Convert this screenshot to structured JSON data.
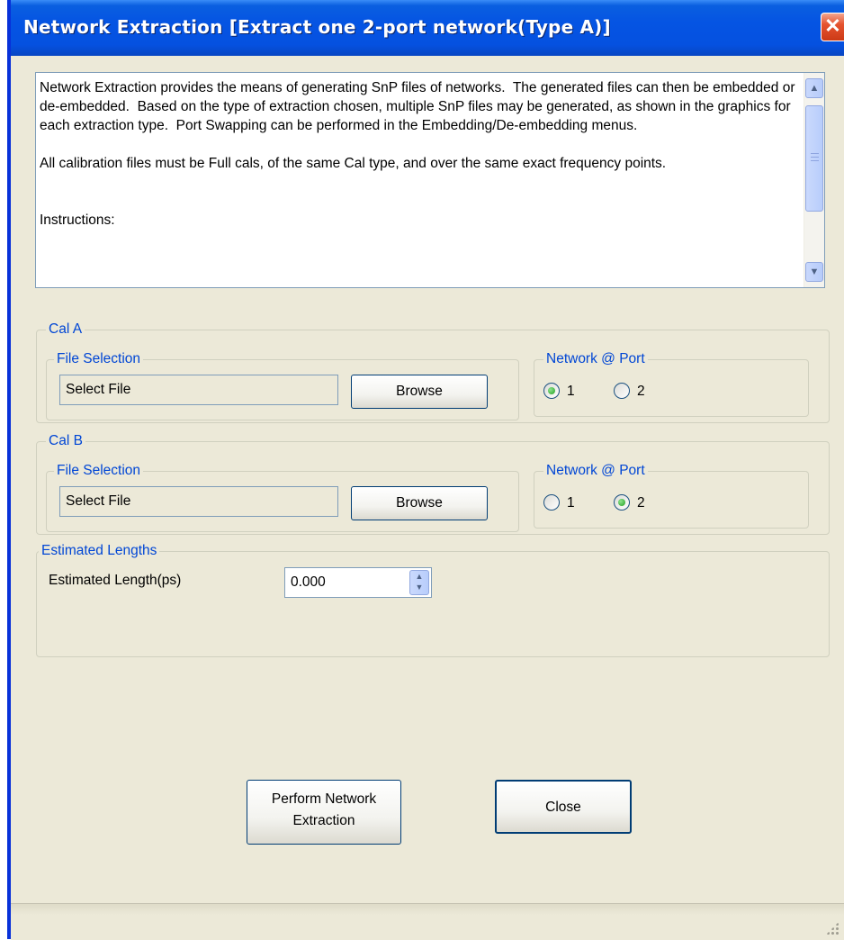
{
  "window": {
    "title": "Network Extraction [Extract one 2-port network(Type A)]",
    "close_symbol": "✕"
  },
  "description": {
    "text": "Network Extraction provides the means of generating SnP files of networks.  The generated files can then be embedded or de-embedded.  Based on the type of extraction chosen, multiple SnP files may be generated, as shown in the graphics for each extraction type.  Port Swapping can be performed in the Embedding/De-embedding menus.\n\nAll calibration files must be Full cals, of the same Cal type, and over the same exact frequency points.\n\n\nInstructions:"
  },
  "cal_a": {
    "label": "Cal A",
    "file_selection_label": "File Selection",
    "file_value": "Select File",
    "browse_label": "Browse",
    "network_port_label": "Network @ Port",
    "port_options": [
      "1",
      "2"
    ],
    "selected_port": "1"
  },
  "cal_b": {
    "label": "Cal B",
    "file_selection_label": "File Selection",
    "file_value": "Select File",
    "browse_label": "Browse",
    "network_port_label": "Network @ Port",
    "port_options": [
      "1",
      "2"
    ],
    "selected_port": "2"
  },
  "estimated_lengths": {
    "label": "Estimated Lengths",
    "field_label": "Estimated Length(ps)",
    "value": "0.000"
  },
  "actions": {
    "perform_label": "Perform Network Extraction",
    "perform_line1": "Perform Network",
    "perform_line2": "Extraction",
    "close_label": "Close"
  },
  "colors": {
    "titlebar": "#0554e3",
    "dialog_bg": "#ece9d8",
    "group_label": "#0046d5",
    "radio_selected": "#21a121"
  },
  "icons": {
    "close": "close-icon",
    "scroll_up": "chevron-up-icon",
    "scroll_down": "chevron-down-icon",
    "spin": "spin-updown-icon",
    "resize": "resize-grip-icon"
  }
}
